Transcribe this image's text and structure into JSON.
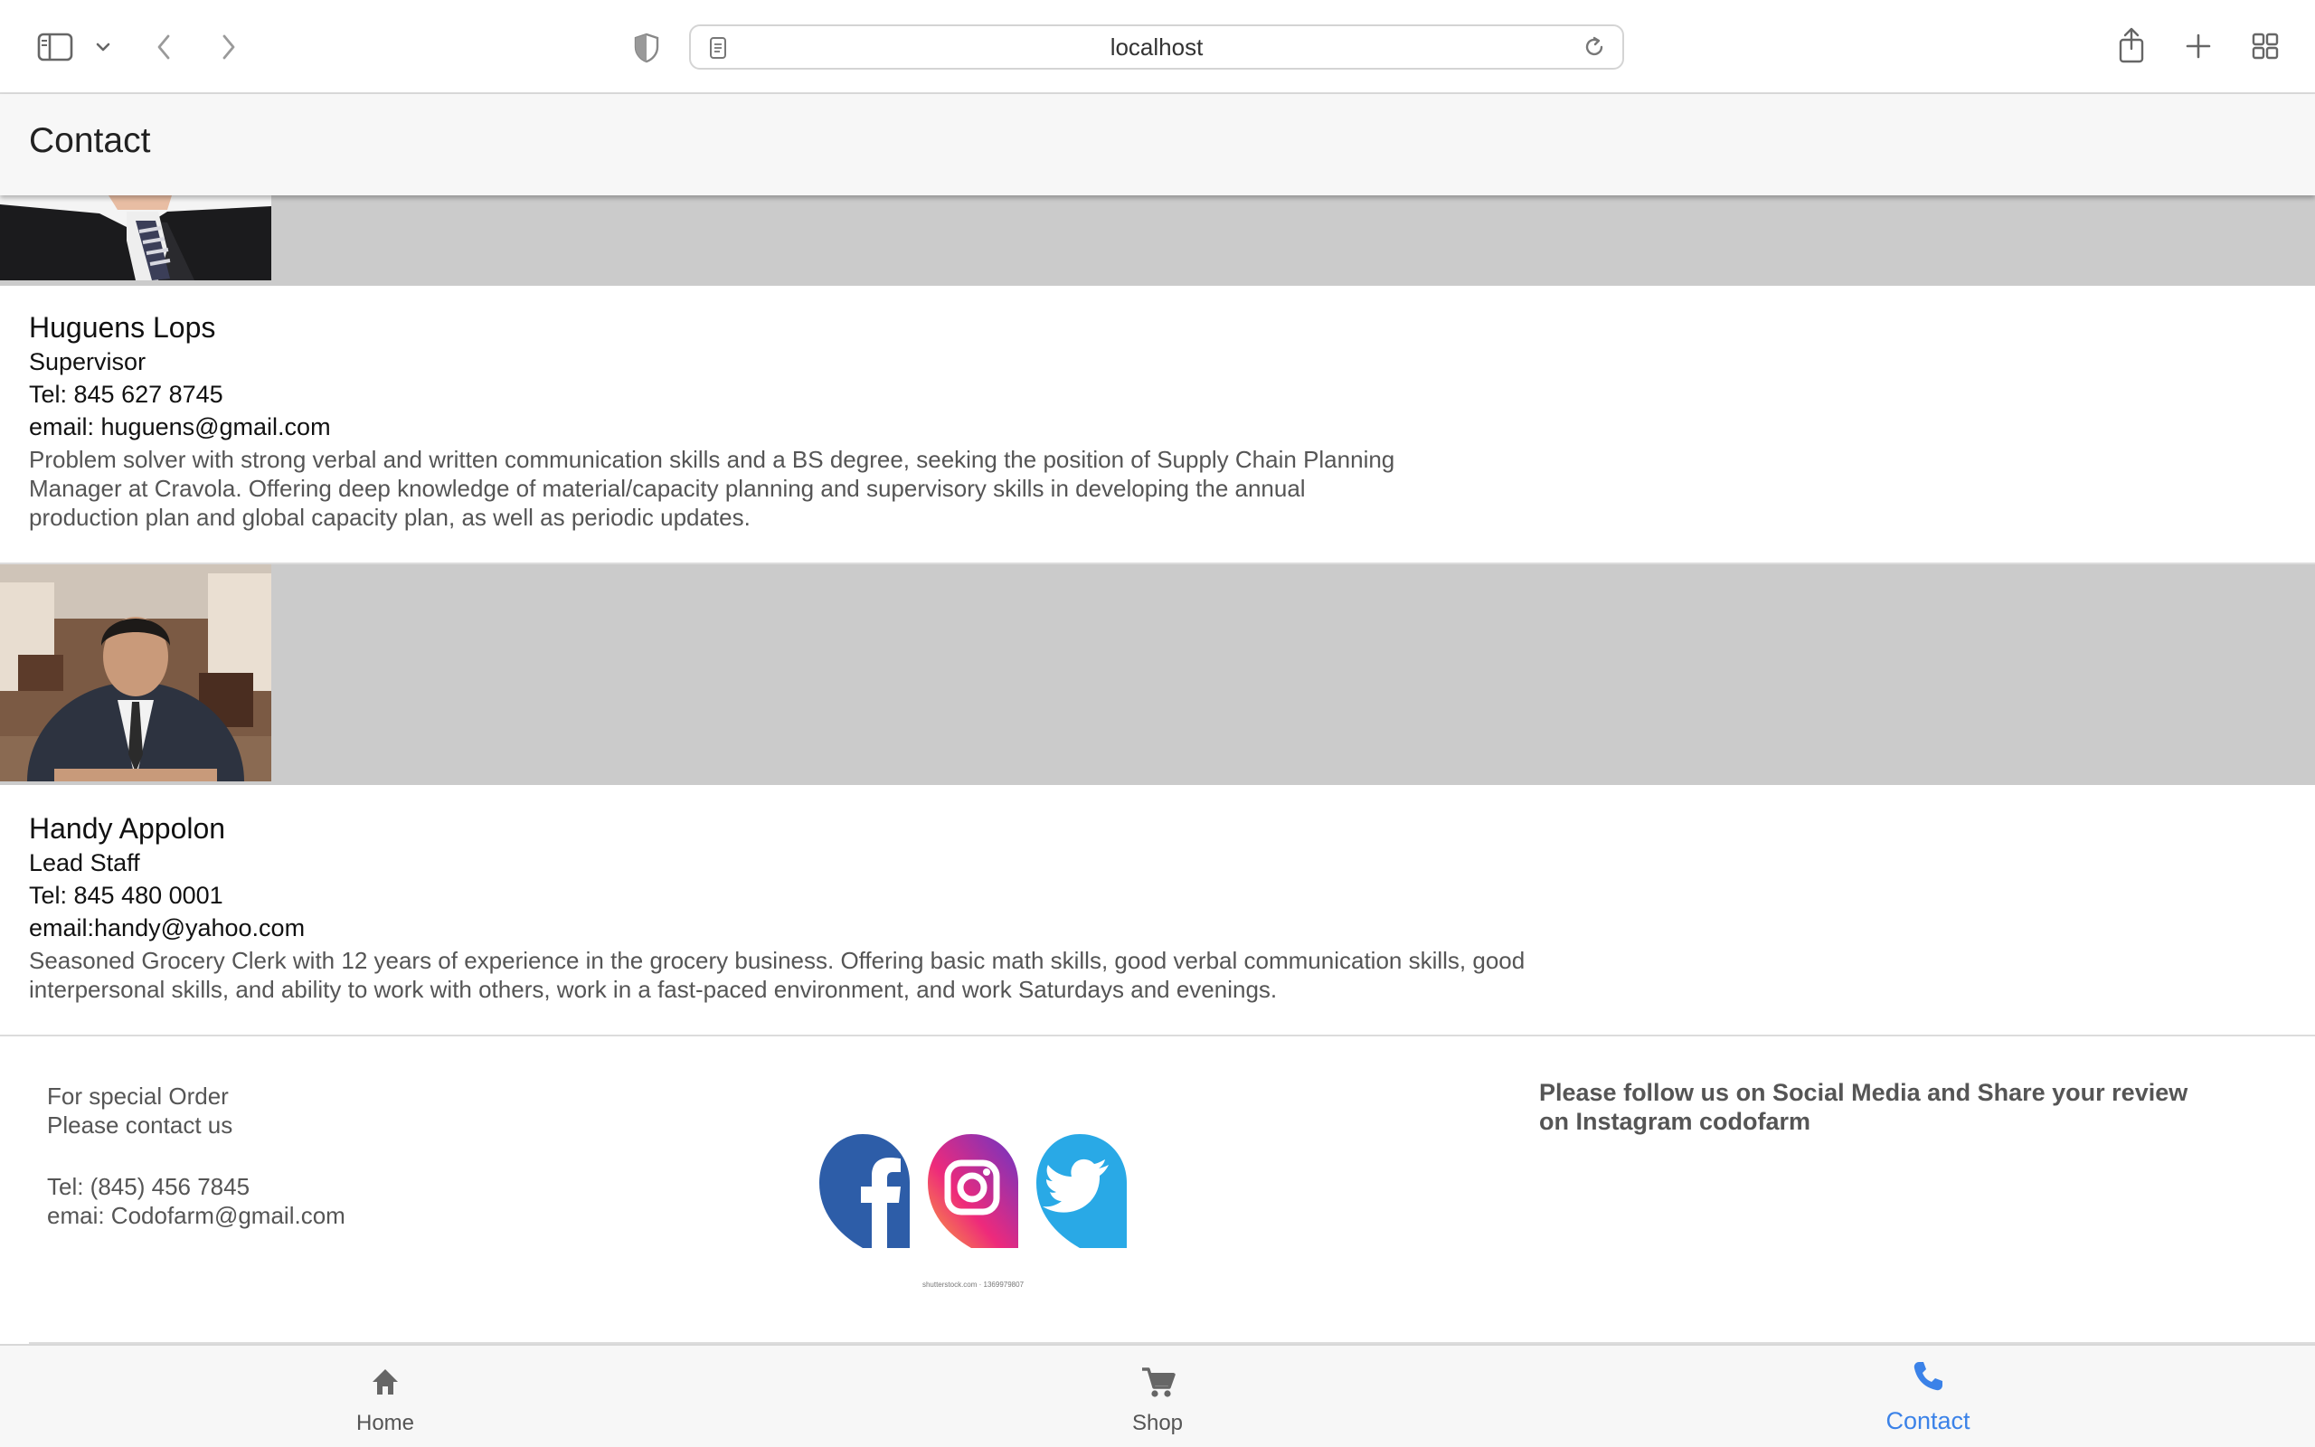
{
  "browser": {
    "url": "localhost"
  },
  "header": {
    "title": "Contact"
  },
  "contacts": [
    {
      "name": "Huguens Lops",
      "role": "Supervisor",
      "tel": "Tel: 845 627 8745",
      "email": "email: huguens@gmail.com",
      "bio": "Problem solver with strong verbal and written communication skills and a BS degree, seeking the position of Supply Chain Planning Manager at Cravola. Offering deep knowledge of material/capacity planning and supervisory skills in developing the annual production plan and global capacity plan, as well as periodic updates."
    },
    {
      "name": "Handy Appolon",
      "role": "Lead Staff",
      "tel": "Tel: 845 480 0001",
      "email": "email:handy@yahoo.com",
      "bio": "Seasoned Grocery Clerk with 12 years of experience in the grocery business. Offering basic math skills, good verbal communication skills, good interpersonal skills, and ability to work with others, work in a fast-paced environment, and work Saturdays and evenings."
    }
  ],
  "footer": {
    "order_line1": "For special Order",
    "order_line2": "Please contact us",
    "tel": "Tel: (845) 456 7845",
    "email": "emai: Codofarm@gmail.com",
    "social_caption": "shutterstock.com · 1369979807",
    "follow_text": "Please follow us on Social Media and Share your review on Instagram codofarm"
  },
  "nav": {
    "items": [
      {
        "label": "Home",
        "icon": "home-icon"
      },
      {
        "label": "Shop",
        "icon": "cart-icon"
      },
      {
        "label": "Contact",
        "icon": "phone-icon",
        "active": true
      }
    ]
  },
  "colors": {
    "accent": "#3b82e8",
    "photo_band": "#cbcbcb",
    "facebook": "#2d5da8",
    "twitter": "#29a9e6"
  }
}
